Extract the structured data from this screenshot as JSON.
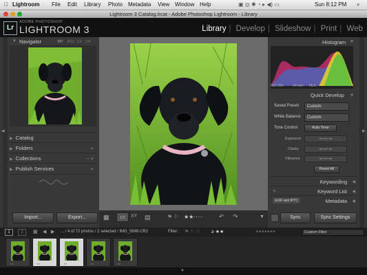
{
  "menubar": {
    "apple_icon": "apple-icon",
    "items": [
      "Lightroom",
      "File",
      "Edit",
      "Library",
      "Photo",
      "Metadata",
      "View",
      "Window",
      "Help"
    ],
    "clock": "Sun 8:12 PM"
  },
  "window": {
    "title": "Lightroom 3 Catalog.lrcat - Adobe Photoshop Lightroom - Library"
  },
  "identity": {
    "logo": "Lr",
    "subtitle": "ADOBE PHOTOSHOP",
    "name": "LIGHTROOM 3"
  },
  "modules": [
    "Library",
    "Develop",
    "Slideshow",
    "Print",
    "Web"
  ],
  "left_panel": {
    "navigator": {
      "title": "Navigator",
      "zoom": [
        "FIT",
        "FILL",
        "1:1",
        "1:4"
      ]
    },
    "sections": [
      {
        "label": "Catalog"
      },
      {
        "label": "Folders"
      },
      {
        "label": "Collections"
      },
      {
        "label": "Publish Services"
      }
    ],
    "import_label": "Import...",
    "export_label": "Export..."
  },
  "right_panel": {
    "histogram_title": "Histogram",
    "exif": [
      "ISO 250",
      "24 mm",
      "f/5.6"
    ],
    "quick_develop_title": "Quick Develop",
    "saved_preset_label": "Saved Preset",
    "saved_preset_value": "Custom",
    "white_balance_label": "White Balance",
    "white_balance_value": "Custom",
    "tone_control_label": "Tone Control",
    "auto_tone_label": "Auto Tone",
    "exposure_label": "Exposure",
    "clarity_label": "Clarity",
    "vibrance_label": "Vibrance",
    "reset_all_label": "Reset All",
    "keywording_title": "Keywording",
    "keyword_list_title": "Keyword List",
    "metadata_title": "Metadata",
    "metadata_preset": "EXIF and IPTC",
    "sync_label": "Sync",
    "sync_settings_label": "Sync Settings"
  },
  "filmstrip": {
    "page1": "1",
    "page2": "2",
    "info": "... / 4 of 72 photos / 2 selected / IMG_5698.CR2",
    "filter_label": "Filter :",
    "rating_filter": "≥ ★★",
    "custom_filter": "Custom Filter",
    "thumb_count": 5,
    "selected_thumbs": [
      1,
      2
    ]
  },
  "colors": {
    "bg": "#2b2b2b",
    "panel": "#383838",
    "grass": "#6fae2c"
  }
}
